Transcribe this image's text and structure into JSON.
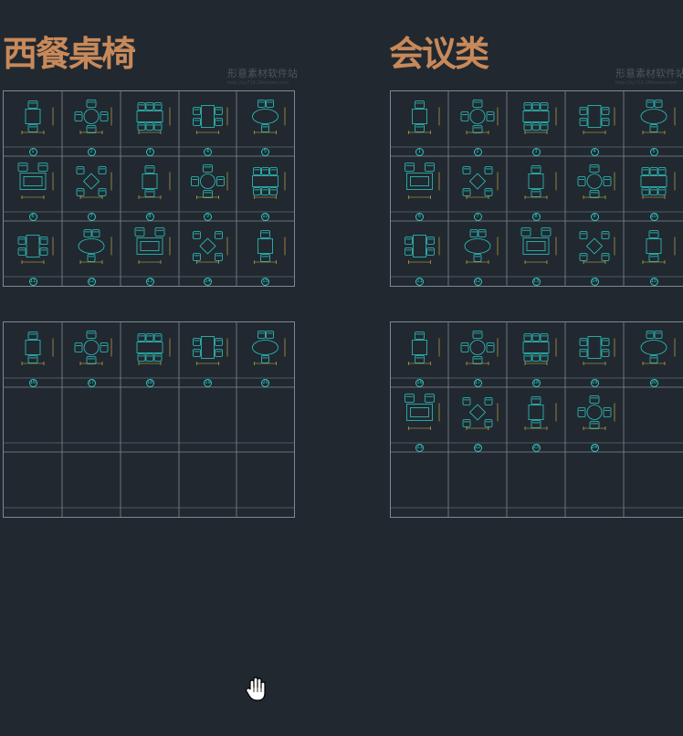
{
  "left": {
    "title": "西餐桌椅",
    "watermark": "形意素材软件站",
    "watermark_url": "http://xy718.28ikaoao.com",
    "top_numbers": [
      "1",
      "2",
      "3",
      "4",
      "5",
      "6",
      "7",
      "8",
      "9",
      "10",
      "11",
      "12",
      "13",
      "14",
      "15"
    ],
    "bottom_numbers": [
      "16",
      "17",
      "18",
      "19",
      "20"
    ]
  },
  "right": {
    "title": "会议类",
    "watermark": "形意素材软件站",
    "watermark_url": "http://xy718.28ikaoao.com",
    "top_numbers": [
      "1",
      "2",
      "3",
      "4",
      "5",
      "6",
      "7",
      "8",
      "9",
      "10",
      "11",
      "12",
      "13",
      "14",
      "15"
    ],
    "bottom_numbers": [
      "16",
      "17",
      "18",
      "19",
      "20",
      "21",
      "22",
      "23",
      "24"
    ]
  },
  "colors": {
    "background": "#212830",
    "title": "#c8895a",
    "grid": "#7f8790",
    "furniture": "#2dc6c0",
    "dimension": "#d8c04a"
  },
  "cursor_icon": "hand-pan-icon"
}
